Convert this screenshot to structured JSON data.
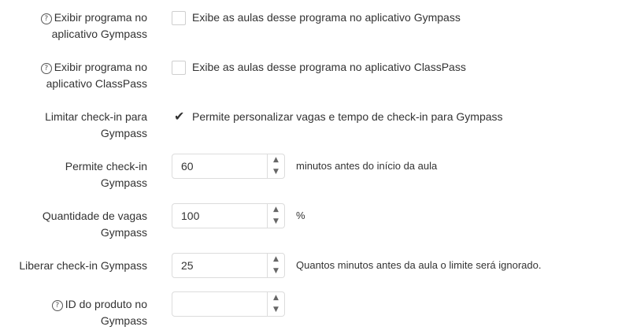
{
  "fields": {
    "gympass_app": {
      "label_line1": "Exibir programa no",
      "label_line2": "aplicativo Gympass",
      "checkbox_text": "Exibe as aulas desse programa no aplicativo Gympass",
      "checked": false
    },
    "classpass_app": {
      "label_line1": "Exibir programa no",
      "label_line2": "aplicativo ClassPass",
      "checkbox_text": "Exibe as aulas desse programa no aplicativo ClassPass",
      "checked": false
    },
    "limit_checkin": {
      "label_line1": "Limitar check-in para",
      "label_line2": "Gympass",
      "checkbox_text": "Permite personalizar vagas e tempo de check-in para Gympass",
      "checked": true
    },
    "permit_checkin": {
      "label_line1": "Permite check-in",
      "label_line2": "Gympass",
      "value": "60",
      "suffix": "minutos antes do início da aula"
    },
    "vacancies": {
      "label_line1": "Quantidade de vagas",
      "label_line2": "Gympass",
      "value": "100",
      "suffix": "%"
    },
    "release_checkin": {
      "label_line1": "Liberar check-in Gympass",
      "value": "25",
      "suffix": "Quantos minutos antes da aula o limite será ignorado."
    },
    "product_id": {
      "label_line1": "ID do produto no",
      "label_line2": "Gympass",
      "value": ""
    }
  },
  "icons": {
    "help": "question-circle-icon",
    "check": "checkmark-icon",
    "up": "chevron-up-icon",
    "down": "chevron-down-icon"
  }
}
